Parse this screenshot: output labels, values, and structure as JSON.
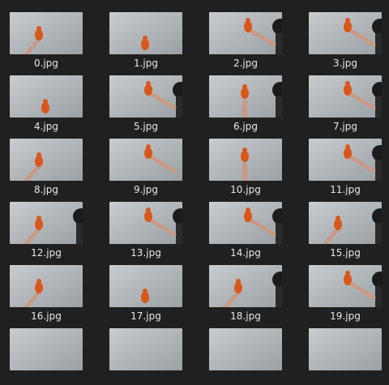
{
  "files": [
    {
      "name": "0.jpg",
      "hand": "left",
      "toy": true,
      "head": false
    },
    {
      "name": "1.jpg",
      "hand": "none",
      "toy": true,
      "head": false
    },
    {
      "name": "2.jpg",
      "hand": "right",
      "toy": true,
      "head": true
    },
    {
      "name": "3.jpg",
      "hand": "right",
      "toy": true,
      "head": true
    },
    {
      "name": "4.jpg",
      "hand": "none",
      "toy": true,
      "head": false
    },
    {
      "name": "5.jpg",
      "hand": "right",
      "toy": true,
      "head": true
    },
    {
      "name": "6.jpg",
      "hand": "center",
      "toy": true,
      "head": true
    },
    {
      "name": "7.jpg",
      "hand": "right",
      "toy": true,
      "head": true
    },
    {
      "name": "8.jpg",
      "hand": "left",
      "toy": true,
      "head": false
    },
    {
      "name": "9.jpg",
      "hand": "right",
      "toy": true,
      "head": false
    },
    {
      "name": "10.jpg",
      "hand": "center",
      "toy": true,
      "head": false
    },
    {
      "name": "11.jpg",
      "hand": "right",
      "toy": true,
      "head": true
    },
    {
      "name": "12.jpg",
      "hand": "left",
      "toy": true,
      "head": true
    },
    {
      "name": "13.jpg",
      "hand": "right",
      "toy": true,
      "head": true
    },
    {
      "name": "14.jpg",
      "hand": "right",
      "toy": true,
      "head": true
    },
    {
      "name": "15.jpg",
      "hand": "left",
      "toy": true,
      "head": true
    },
    {
      "name": "16.jpg",
      "hand": "left",
      "toy": true,
      "head": false
    },
    {
      "name": "17.jpg",
      "hand": "none",
      "toy": true,
      "head": false
    },
    {
      "name": "18.jpg",
      "hand": "left",
      "toy": true,
      "head": true
    },
    {
      "name": "19.jpg",
      "hand": "right",
      "toy": true,
      "head": true
    },
    {
      "name": "",
      "hand": "none",
      "toy": false,
      "head": false
    },
    {
      "name": "",
      "hand": "none",
      "toy": false,
      "head": false
    },
    {
      "name": "",
      "hand": "none",
      "toy": false,
      "head": false
    },
    {
      "name": "",
      "hand": "none",
      "toy": false,
      "head": false
    }
  ],
  "colors": {
    "background": "#202020",
    "wall_light": "#c9cccf",
    "wall_dark": "#9aa0a4",
    "toy": "#d9571b",
    "skin": "#c89a86",
    "hair": "#1b1b1b",
    "label_text": "#e8e8e8"
  }
}
